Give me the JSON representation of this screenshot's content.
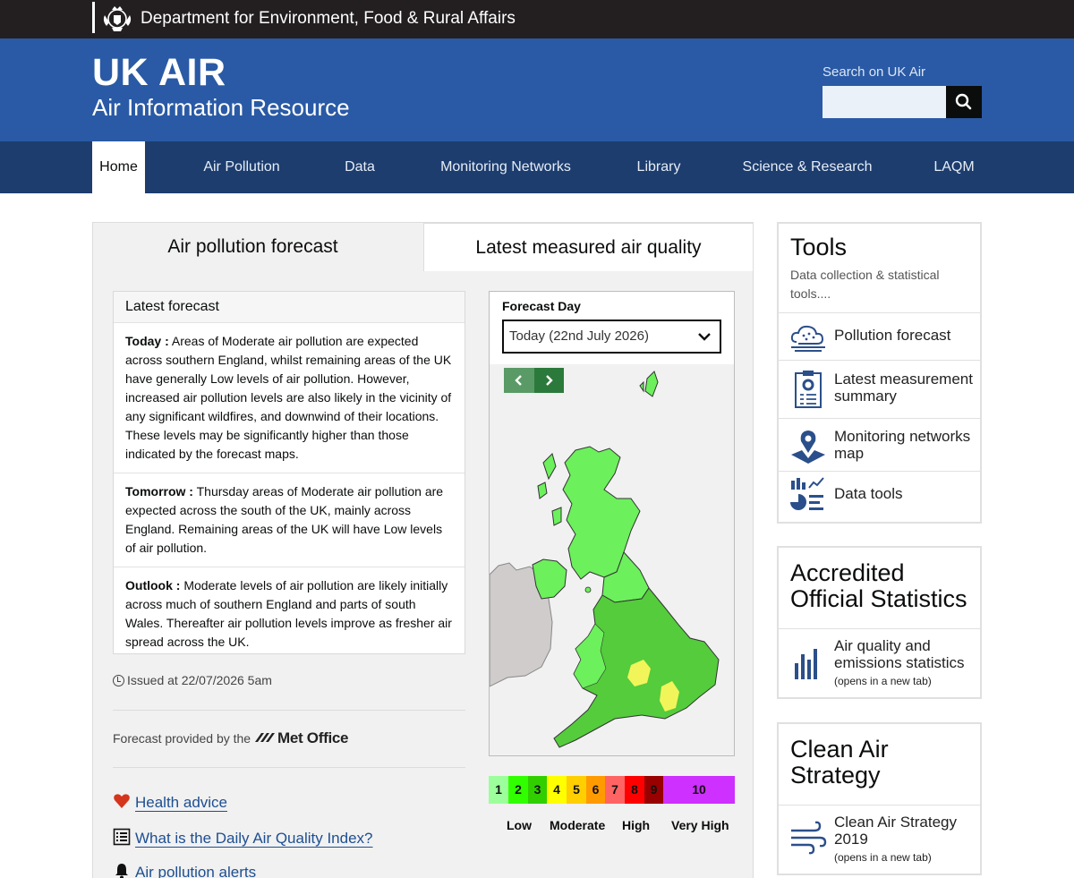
{
  "topbar": {
    "department": "Department for Environment, Food & Rural Affairs"
  },
  "header": {
    "title": "UK AIR",
    "subtitle": "Air Information Resource",
    "search_label": "Search on UK Air",
    "search_value": ""
  },
  "nav": {
    "items": [
      {
        "label": "Home"
      },
      {
        "label": "Air Pollution"
      },
      {
        "label": "Data"
      },
      {
        "label": "Monitoring Networks"
      },
      {
        "label": "Library"
      },
      {
        "label": "Science & Research"
      },
      {
        "label": "LAQM"
      }
    ]
  },
  "tabs": {
    "forecast": "Air pollution forecast",
    "measured": "Latest measured air quality"
  },
  "forecast": {
    "heading": "Latest forecast",
    "today_label": "Today :",
    "today_text": " Areas of Moderate air pollution are expected across southern England, whilst remaining areas of the UK have generally Low levels of air pollution. However, increased air pollution levels are also likely in the vicinity of any significant wildfires, and downwind of their locations. These levels may be significantly higher than those indicated by the forecast maps.",
    "tomorrow_label": "Tomorrow :",
    "tomorrow_text": " Thursday areas of Moderate air pollution are expected across the south of the UK, mainly across England. Remaining areas of the UK will have Low levels of air pollution.",
    "outlook_label": "Outlook :",
    "outlook_text": " Moderate levels of air pollution are likely initially across much of southern England and parts of south Wales. Thereafter air pollution levels improve as fresher air spread across the UK.",
    "issued": "Issued at 22/07/2026 5am",
    "provided_by": "Forecast provided by the",
    "met_office": "Met Office"
  },
  "links": {
    "health": "Health advice",
    "daqi": "What is the Daily Air Quality Index?",
    "alerts": "Air pollution alerts"
  },
  "map": {
    "forecast_day_label": "Forecast Day",
    "selected_day": "Today (22nd July 2026)"
  },
  "scale": {
    "cells": [
      "1",
      "2",
      "3",
      "4",
      "5",
      "6",
      "7",
      "8",
      "9",
      "10"
    ],
    "colors": [
      "#9cff9c",
      "#31ff00",
      "#31cf00",
      "#ffff00",
      "#ffcf00",
      "#ff9a00",
      "#ff6464",
      "#ff0000",
      "#990000",
      "#ce30ff"
    ],
    "bands": [
      "Low",
      "Moderate",
      "High",
      "Very High"
    ]
  },
  "tools": {
    "title": "Tools",
    "desc": "Data collection & statistical tools....",
    "items": [
      {
        "label": "Pollution forecast"
      },
      {
        "label": "Latest measurement summary"
      },
      {
        "label": "Monitoring networks map"
      },
      {
        "label": "Data tools"
      }
    ]
  },
  "stats": {
    "title": "Accredited Official Statistics",
    "item_label": "Air quality and emissions statistics",
    "item_note": "(opens in a new tab)"
  },
  "cleanair": {
    "title": "Clean Air Strategy",
    "item_label": "Clean Air Strategy 2019",
    "item_note": "(opens in a new tab)"
  }
}
